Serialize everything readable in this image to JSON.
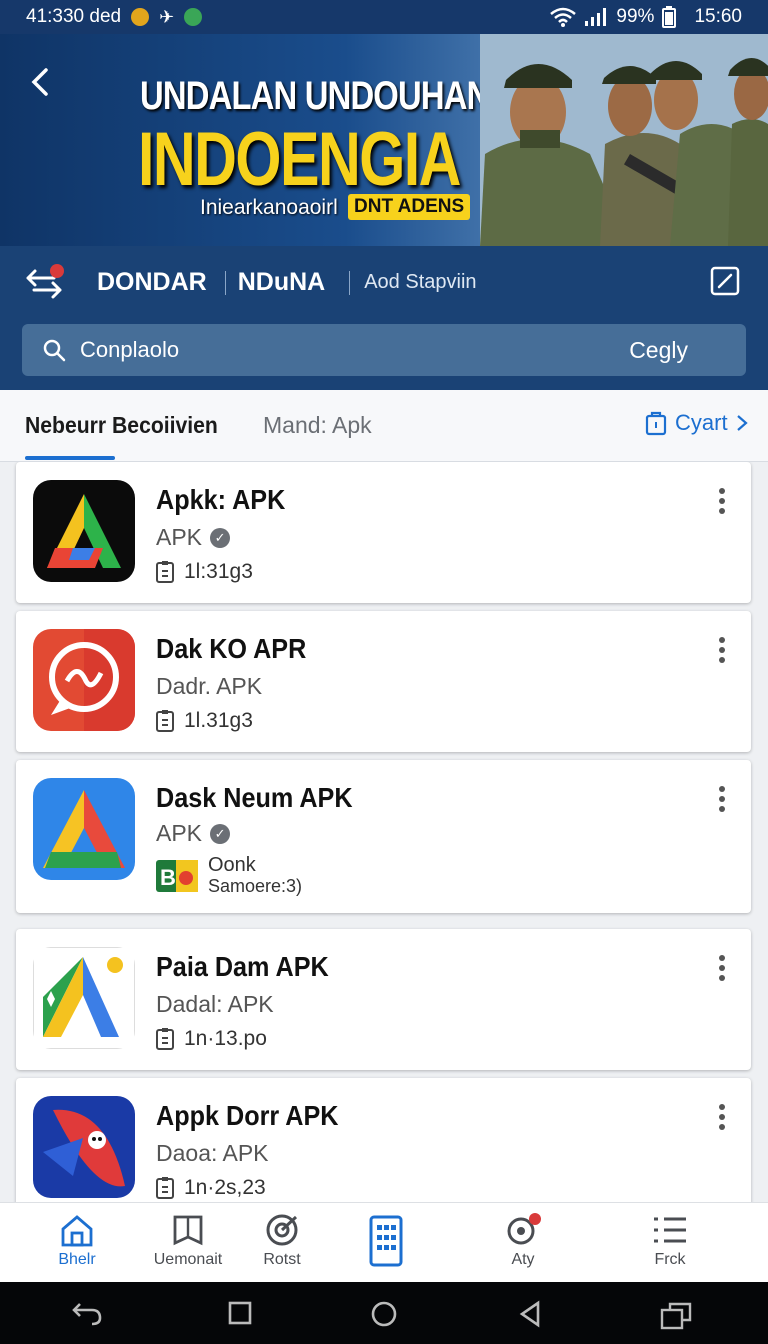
{
  "status_bar": {
    "left_text": "41:330 ded",
    "battery": "99%",
    "time": "15:60"
  },
  "banner": {
    "title_line1": "UNDALAN UNDOUHAN",
    "title_line2": "INDOENGIA",
    "subtitle": "Iniearkanoaoirl",
    "tag": "DNT ADENS"
  },
  "header": {
    "nav1": "DONDAR",
    "nav2": "NDuNA",
    "nav3": "Aod Stapviin"
  },
  "search": {
    "placeholder": "Conplaolo",
    "button": "Cegly"
  },
  "tabs": {
    "tab1": "Nebeurr Becoiivien",
    "tab2": "Mand: Apk",
    "cart": "Cyart"
  },
  "apps": [
    {
      "name": "Apkk: APK",
      "sub": "APK",
      "meta": "1l:31g3"
    },
    {
      "name": "Dak KO APR",
      "sub": "Dadr. APK",
      "meta": "1l.31g3"
    },
    {
      "name": "Dask Neum APK",
      "sub": "APK",
      "meta_line1": "Oonk",
      "meta_line2": "Samoere:3)"
    },
    {
      "name": "Paia Dam APK",
      "sub": "Dadal: APK",
      "meta": "1n·13.po"
    },
    {
      "name": "Appk Dorr APK",
      "sub": "Daoa: APK",
      "meta": "1n·2s,23"
    }
  ],
  "bottom_nav": [
    "Bhelr",
    "Uemonait",
    "Rotst",
    "",
    "Aty",
    "Frck"
  ],
  "colors": {
    "header_bg": "#1a4275",
    "accent": "#1c6fd0",
    "banner_yellow": "#f7d21c"
  }
}
